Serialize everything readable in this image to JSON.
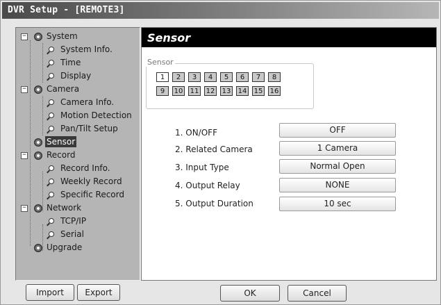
{
  "window": {
    "title": "DVR Setup - [REMOTE3]"
  },
  "tree": {
    "system": {
      "label": "System",
      "children": [
        "System Info.",
        "Time",
        "Display"
      ]
    },
    "camera": {
      "label": "Camera",
      "children": [
        "Camera Info.",
        "Motion Detection",
        "Pan/Tilt Setup"
      ]
    },
    "sensor": {
      "label": "Sensor"
    },
    "record": {
      "label": "Record",
      "children": [
        "Record Info.",
        "Weekly Record",
        "Specific Record"
      ]
    },
    "network": {
      "label": "Network",
      "children": [
        "TCP/IP",
        "Serial"
      ]
    },
    "upgrade": {
      "label": "Upgrade"
    },
    "toggle_expanded": "−",
    "selected": "Sensor"
  },
  "panel": {
    "title": "Sensor",
    "sensor_group_label": "Sensor",
    "sensors": [
      "1",
      "2",
      "3",
      "4",
      "5",
      "6",
      "7",
      "8",
      "9",
      "10",
      "11",
      "12",
      "13",
      "14",
      "15",
      "16"
    ],
    "active_sensor": "1",
    "fields": [
      {
        "label": "1. ON/OFF",
        "value": "OFF"
      },
      {
        "label": "2. Related Camera",
        "value": "1 Camera"
      },
      {
        "label": "3. Input Type",
        "value": "Normal Open"
      },
      {
        "label": "4. Output Relay",
        "value": "NONE"
      },
      {
        "label": "5. Output Duration",
        "value": "10 sec"
      }
    ]
  },
  "buttons": {
    "import": "Import",
    "export": "Export",
    "ok": "OK",
    "cancel": "Cancel"
  }
}
